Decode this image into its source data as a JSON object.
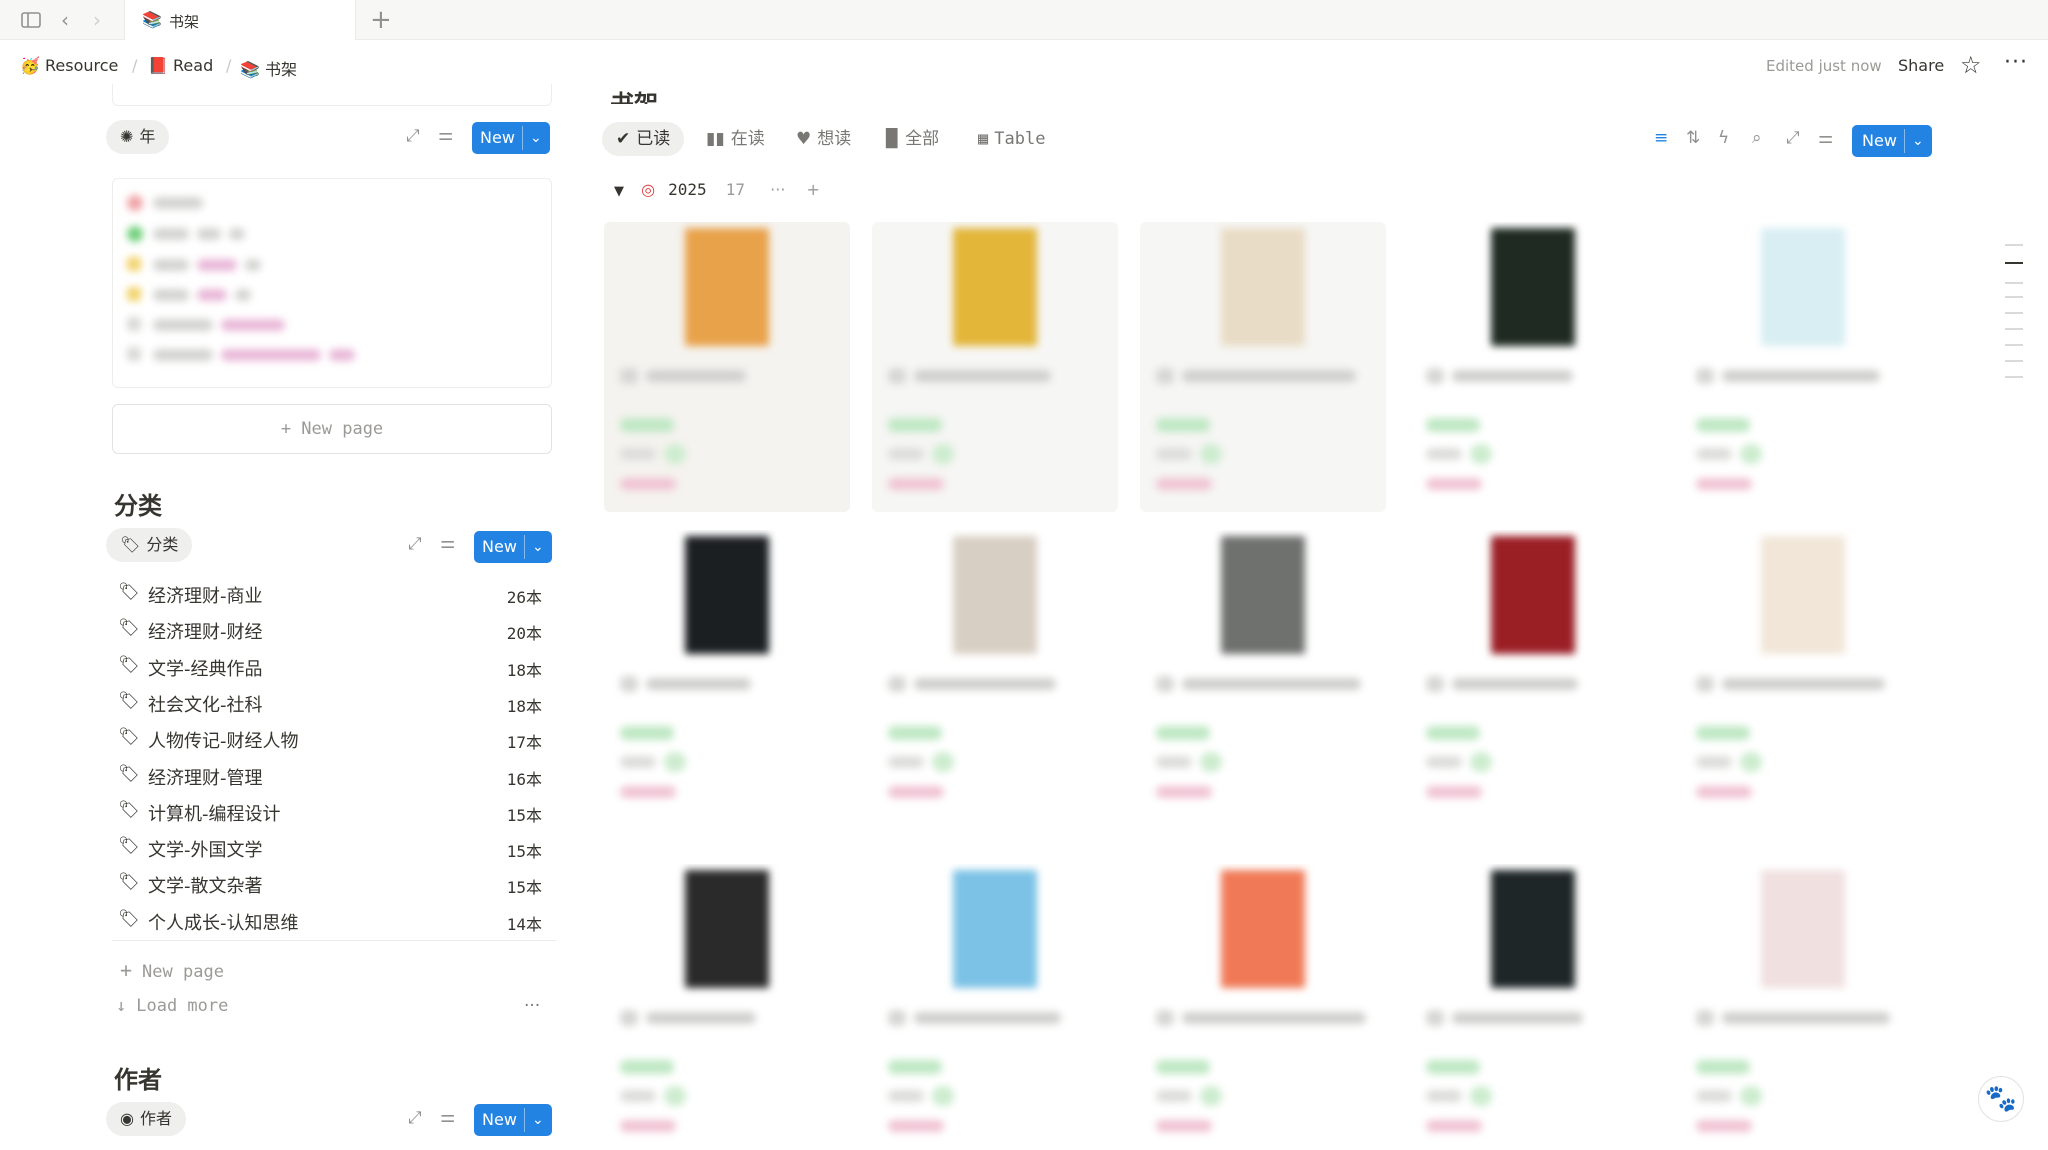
{
  "tabbar": {
    "tab": {
      "icon": "📚",
      "title": "书架"
    }
  },
  "breadcrumb": {
    "items": [
      {
        "icon": "🥳",
        "label": "Resource"
      },
      {
        "icon": "📕",
        "label": "Read"
      },
      {
        "icon": "📚",
        "label": "书架"
      }
    ],
    "edited": "Edited just now",
    "share": "Share"
  },
  "year_section": {
    "chip": "年",
    "new_label": "New",
    "new_page": "+ New page"
  },
  "category_section": {
    "title": "分类",
    "chip": "分类",
    "new_label": "New",
    "items": [
      {
        "name": "经济理财-商业",
        "count": "26本"
      },
      {
        "name": "经济理财-财经",
        "count": "20本"
      },
      {
        "name": "文学-经典作品",
        "count": "18本"
      },
      {
        "name": "社会文化-社科",
        "count": "18本"
      },
      {
        "name": "人物传记-财经人物",
        "count": "17本"
      },
      {
        "name": "经济理财-管理",
        "count": "16本"
      },
      {
        "name": "计算机-编程设计",
        "count": "15本"
      },
      {
        "name": "文学-外国文学",
        "count": "15本"
      },
      {
        "name": "文学-散文杂著",
        "count": "15本"
      },
      {
        "name": "个人成长-认知思维",
        "count": "14本"
      }
    ],
    "new_page": "New page",
    "load_more": "Load more"
  },
  "author_section": {
    "title": "作者",
    "chip": "作者",
    "new_label": "New"
  },
  "main": {
    "page_title": "书架",
    "views": [
      {
        "icon": "check-circle-icon",
        "label": "已读",
        "active": true
      },
      {
        "icon": "book-open-icon",
        "label": "在读",
        "active": false
      },
      {
        "icon": "heart-icon",
        "label": "想读",
        "active": false
      },
      {
        "icon": "book-icon",
        "label": "全部",
        "active": false
      },
      {
        "icon": "table-icon",
        "label": "Table",
        "active": false
      }
    ],
    "new_label": "New",
    "group": {
      "label": "2025",
      "count": "17"
    }
  },
  "colors": {
    "accent": "#2383e2",
    "chip_bg": "#efefed",
    "text": "#37352f",
    "muted": "#9b9a97"
  }
}
